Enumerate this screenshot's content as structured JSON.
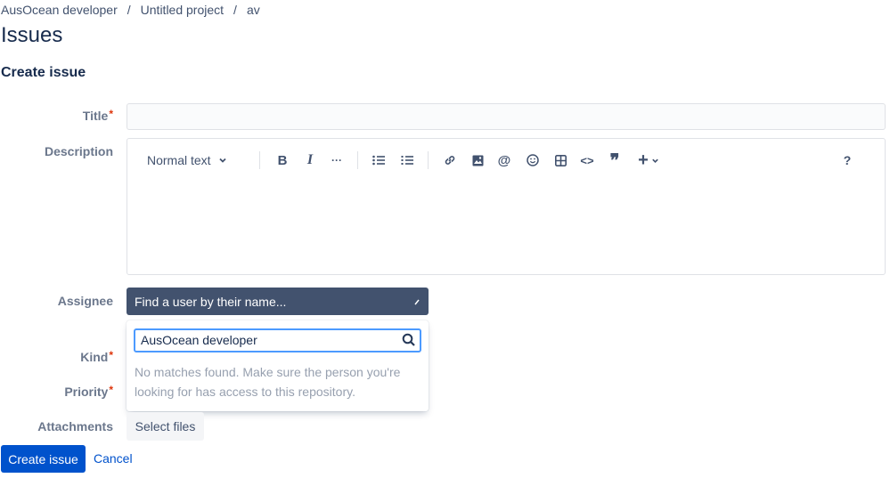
{
  "breadcrumb": {
    "items": [
      "AusOcean developer",
      "Untitled project",
      "av"
    ],
    "separator": "/"
  },
  "page": {
    "title": "Issues",
    "section_title": "Create issue"
  },
  "form": {
    "title_label": "Title",
    "description_label": "Description",
    "assignee_label": "Assignee",
    "kind_label": "Kind",
    "priority_label": "Priority",
    "attachments_label": "Attachments",
    "required_marker": "*",
    "title_value": ""
  },
  "editor_toolbar": {
    "text_style": "Normal text",
    "icons": [
      "chevron-down-icon",
      "bold-icon",
      "italic-icon",
      "more-icon",
      "bullet-list-icon",
      "numbered-list-icon",
      "link-icon",
      "image-icon",
      "mention-icon",
      "emoji-icon",
      "table-icon",
      "code-icon",
      "quote-icon",
      "insert-icon",
      "help-icon"
    ],
    "bold": "B",
    "italic": "I",
    "more": "···",
    "mention": "@",
    "code": "<>",
    "quote": "❞",
    "insert": "+",
    "help": "?"
  },
  "assignee": {
    "placeholder": "Find a user by their name...",
    "search_value": "AusOcean developer",
    "no_matches_text": "No matches found. Make sure the person you're looking for has access to this repository."
  },
  "attachments": {
    "select_files_label": "Select files"
  },
  "actions": {
    "create_label": "Create issue",
    "cancel_label": "Cancel"
  },
  "colors": {
    "primary": "#0052cc",
    "select_dark": "#42526e",
    "required": "#de350b",
    "focus_border": "#4c9aff"
  }
}
